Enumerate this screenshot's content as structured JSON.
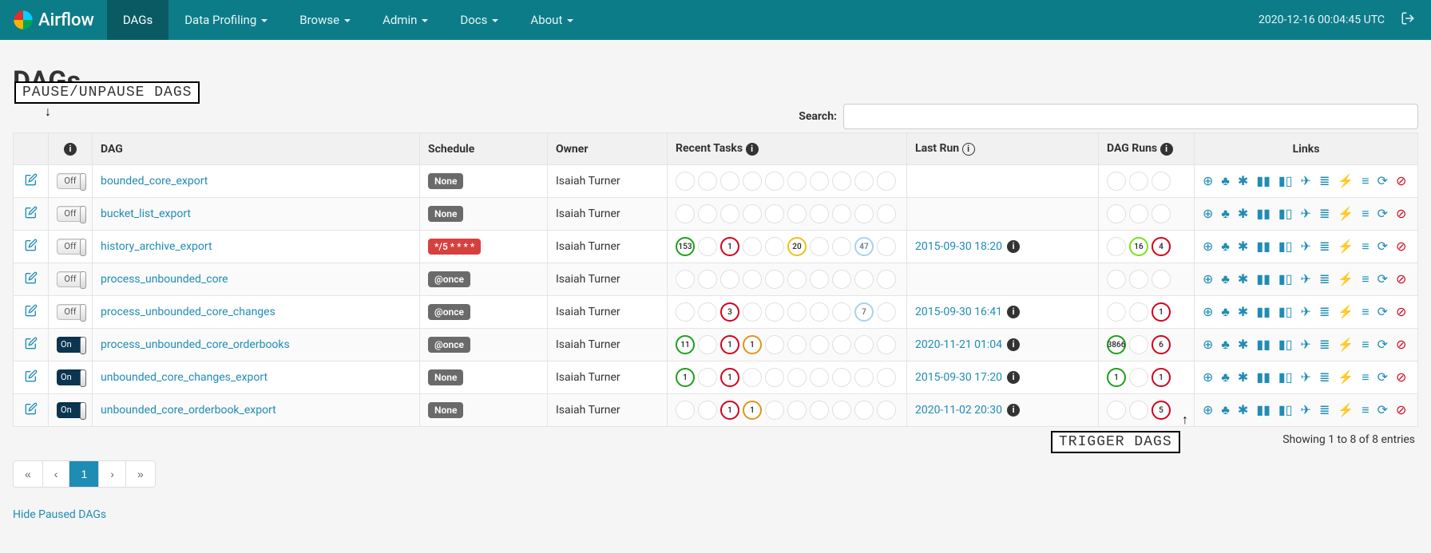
{
  "nav": {
    "brand": "Airflow",
    "items": [
      {
        "label": "DAGs",
        "active": true,
        "caret": false
      },
      {
        "label": "Data Profiling",
        "active": false,
        "caret": true
      },
      {
        "label": "Browse",
        "active": false,
        "caret": true
      },
      {
        "label": "Admin",
        "active": false,
        "caret": true
      },
      {
        "label": "Docs",
        "active": false,
        "caret": true
      },
      {
        "label": "About",
        "active": false,
        "caret": true
      }
    ],
    "clock": "2020-12-16 00:04:45 UTC"
  },
  "page_title": "DAGs",
  "annotations": {
    "pause": "PAUSE/UNPAUSE DAGS",
    "trigger": "TRIGGER DAGS"
  },
  "search": {
    "label": "Search:",
    "value": ""
  },
  "table": {
    "headers": {
      "dag": "DAG",
      "schedule": "Schedule",
      "owner": "Owner",
      "recent": "Recent Tasks",
      "last_run": "Last Run",
      "dag_runs": "DAG Runs",
      "links": "Links"
    },
    "rows": [
      {
        "paused": true,
        "toggle_label": "Off",
        "dag_id": "bounded_core_export",
        "schedule": "None",
        "schedule_style": "plain",
        "owner": "Isaiah Turner",
        "recent": [
          {},
          {},
          {},
          {},
          {},
          {},
          {},
          {},
          {},
          {}
        ],
        "last_run": "",
        "dag_runs": [
          {},
          {},
          {}
        ]
      },
      {
        "paused": true,
        "toggle_label": "Off",
        "dag_id": "bucket_list_export",
        "schedule": "None",
        "schedule_style": "plain",
        "owner": "Isaiah Turner",
        "recent": [
          {},
          {},
          {},
          {},
          {},
          {},
          {},
          {},
          {},
          {}
        ],
        "last_run": "",
        "dag_runs": [
          {},
          {},
          {}
        ]
      },
      {
        "paused": true,
        "toggle_label": "Off",
        "dag_id": "history_archive_export",
        "schedule": "*/5 * * * *",
        "schedule_style": "cron",
        "owner": "Isaiah Turner",
        "recent": [
          {
            "v": "153",
            "c": "success"
          },
          {},
          {
            "v": "1",
            "c": "failed"
          },
          {},
          {},
          {
            "v": "20",
            "c": "up_retry"
          },
          {},
          {},
          {
            "v": "47",
            "c": "shrun"
          },
          {}
        ],
        "last_run": "2015-09-30 18:20",
        "dag_runs": [
          {},
          {
            "v": "16",
            "c": "lime"
          },
          {
            "v": "4",
            "c": "failed"
          }
        ]
      },
      {
        "paused": true,
        "toggle_label": "Off",
        "dag_id": "process_unbounded_core",
        "schedule": "@once",
        "schedule_style": "plain",
        "owner": "Isaiah Turner",
        "recent": [
          {},
          {},
          {},
          {},
          {},
          {},
          {},
          {},
          {},
          {}
        ],
        "last_run": "",
        "dag_runs": [
          {},
          {},
          {}
        ]
      },
      {
        "paused": true,
        "toggle_label": "Off",
        "dag_id": "process_unbounded_core_changes",
        "schedule": "@once",
        "schedule_style": "plain",
        "owner": "Isaiah Turner",
        "recent": [
          {},
          {},
          {
            "v": "3",
            "c": "failed"
          },
          {},
          {},
          {},
          {},
          {},
          {
            "v": "7",
            "c": "shrun"
          },
          {}
        ],
        "last_run": "2015-09-30 16:41",
        "dag_runs": [
          {},
          {},
          {
            "v": "1",
            "c": "failed"
          }
        ]
      },
      {
        "paused": false,
        "toggle_label": "On",
        "dag_id": "process_unbounded_core_orderbooks",
        "schedule": "@once",
        "schedule_style": "plain",
        "owner": "Isaiah Turner",
        "recent": [
          {
            "v": "11",
            "c": "success"
          },
          {},
          {
            "v": "1",
            "c": "failed"
          },
          {
            "v": "1",
            "c": "orange"
          },
          {},
          {},
          {},
          {},
          {},
          {}
        ],
        "last_run": "2020-11-21 01:04",
        "dag_runs": [
          {
            "v": "3866",
            "c": "success"
          },
          {},
          {
            "v": "6",
            "c": "failed"
          }
        ]
      },
      {
        "paused": false,
        "toggle_label": "On",
        "dag_id": "unbounded_core_changes_export",
        "schedule": "None",
        "schedule_style": "plain",
        "owner": "Isaiah Turner",
        "recent": [
          {
            "v": "1",
            "c": "success"
          },
          {},
          {
            "v": "1",
            "c": "failed"
          },
          {},
          {},
          {},
          {},
          {},
          {},
          {}
        ],
        "last_run": "2015-09-30 17:20",
        "dag_runs": [
          {
            "v": "1",
            "c": "success"
          },
          {},
          {
            "v": "1",
            "c": "failed"
          }
        ]
      },
      {
        "paused": false,
        "toggle_label": "On",
        "dag_id": "unbounded_core_orderbook_export",
        "schedule": "None",
        "schedule_style": "plain",
        "owner": "Isaiah Turner",
        "recent": [
          {},
          {},
          {
            "v": "1",
            "c": "failed"
          },
          {
            "v": "1",
            "c": "orange"
          },
          {},
          {},
          {},
          {},
          {},
          {}
        ],
        "last_run": "2020-11-02 20:30",
        "dag_runs": [
          {},
          {},
          {
            "v": "5",
            "c": "failed"
          }
        ]
      }
    ]
  },
  "footer": {
    "showing": "Showing 1 to 8 of 8 entries",
    "page_current": "1",
    "hide_link": "Hide Paused DAGs"
  },
  "link_icons": [
    {
      "name": "trigger-dag-icon",
      "glyph": "⊕"
    },
    {
      "name": "tree-view-icon",
      "glyph": "♣"
    },
    {
      "name": "graph-view-icon",
      "glyph": "✱"
    },
    {
      "name": "tasks-duration-icon",
      "glyph": "▮▮"
    },
    {
      "name": "task-tries-icon",
      "glyph": "▮▯"
    },
    {
      "name": "landing-times-icon",
      "glyph": "✈"
    },
    {
      "name": "gantt-icon",
      "glyph": "≣"
    },
    {
      "name": "zap-icon",
      "glyph": "⚡"
    },
    {
      "name": "logs-icon",
      "glyph": "≡"
    },
    {
      "name": "refresh-icon",
      "glyph": "⟳"
    },
    {
      "name": "delete-dag-icon",
      "glyph": "⊘",
      "danger": true
    }
  ]
}
